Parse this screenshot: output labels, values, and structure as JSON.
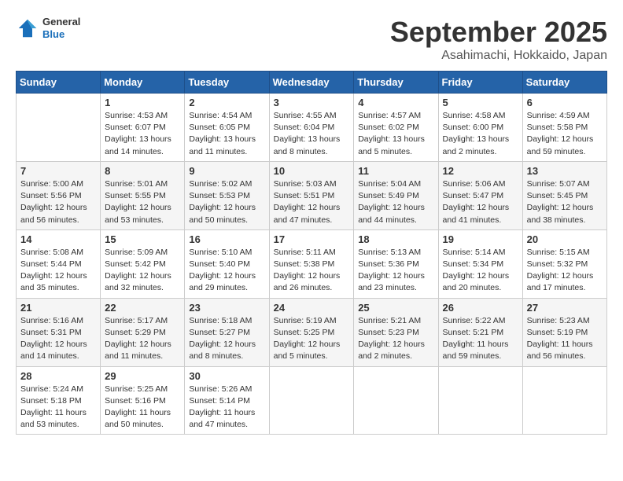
{
  "header": {
    "logo_general": "General",
    "logo_blue": "Blue",
    "month": "September 2025",
    "location": "Asahimachi, Hokkaido, Japan"
  },
  "weekdays": [
    "Sunday",
    "Monday",
    "Tuesday",
    "Wednesday",
    "Thursday",
    "Friday",
    "Saturday"
  ],
  "weeks": [
    [
      {
        "day": "",
        "info": ""
      },
      {
        "day": "1",
        "info": "Sunrise: 4:53 AM\nSunset: 6:07 PM\nDaylight: 13 hours\nand 14 minutes."
      },
      {
        "day": "2",
        "info": "Sunrise: 4:54 AM\nSunset: 6:05 PM\nDaylight: 13 hours\nand 11 minutes."
      },
      {
        "day": "3",
        "info": "Sunrise: 4:55 AM\nSunset: 6:04 PM\nDaylight: 13 hours\nand 8 minutes."
      },
      {
        "day": "4",
        "info": "Sunrise: 4:57 AM\nSunset: 6:02 PM\nDaylight: 13 hours\nand 5 minutes."
      },
      {
        "day": "5",
        "info": "Sunrise: 4:58 AM\nSunset: 6:00 PM\nDaylight: 13 hours\nand 2 minutes."
      },
      {
        "day": "6",
        "info": "Sunrise: 4:59 AM\nSunset: 5:58 PM\nDaylight: 12 hours\nand 59 minutes."
      }
    ],
    [
      {
        "day": "7",
        "info": "Sunrise: 5:00 AM\nSunset: 5:56 PM\nDaylight: 12 hours\nand 56 minutes."
      },
      {
        "day": "8",
        "info": "Sunrise: 5:01 AM\nSunset: 5:55 PM\nDaylight: 12 hours\nand 53 minutes."
      },
      {
        "day": "9",
        "info": "Sunrise: 5:02 AM\nSunset: 5:53 PM\nDaylight: 12 hours\nand 50 minutes."
      },
      {
        "day": "10",
        "info": "Sunrise: 5:03 AM\nSunset: 5:51 PM\nDaylight: 12 hours\nand 47 minutes."
      },
      {
        "day": "11",
        "info": "Sunrise: 5:04 AM\nSunset: 5:49 PM\nDaylight: 12 hours\nand 44 minutes."
      },
      {
        "day": "12",
        "info": "Sunrise: 5:06 AM\nSunset: 5:47 PM\nDaylight: 12 hours\nand 41 minutes."
      },
      {
        "day": "13",
        "info": "Sunrise: 5:07 AM\nSunset: 5:45 PM\nDaylight: 12 hours\nand 38 minutes."
      }
    ],
    [
      {
        "day": "14",
        "info": "Sunrise: 5:08 AM\nSunset: 5:44 PM\nDaylight: 12 hours\nand 35 minutes."
      },
      {
        "day": "15",
        "info": "Sunrise: 5:09 AM\nSunset: 5:42 PM\nDaylight: 12 hours\nand 32 minutes."
      },
      {
        "day": "16",
        "info": "Sunrise: 5:10 AM\nSunset: 5:40 PM\nDaylight: 12 hours\nand 29 minutes."
      },
      {
        "day": "17",
        "info": "Sunrise: 5:11 AM\nSunset: 5:38 PM\nDaylight: 12 hours\nand 26 minutes."
      },
      {
        "day": "18",
        "info": "Sunrise: 5:13 AM\nSunset: 5:36 PM\nDaylight: 12 hours\nand 23 minutes."
      },
      {
        "day": "19",
        "info": "Sunrise: 5:14 AM\nSunset: 5:34 PM\nDaylight: 12 hours\nand 20 minutes."
      },
      {
        "day": "20",
        "info": "Sunrise: 5:15 AM\nSunset: 5:32 PM\nDaylight: 12 hours\nand 17 minutes."
      }
    ],
    [
      {
        "day": "21",
        "info": "Sunrise: 5:16 AM\nSunset: 5:31 PM\nDaylight: 12 hours\nand 14 minutes."
      },
      {
        "day": "22",
        "info": "Sunrise: 5:17 AM\nSunset: 5:29 PM\nDaylight: 12 hours\nand 11 minutes."
      },
      {
        "day": "23",
        "info": "Sunrise: 5:18 AM\nSunset: 5:27 PM\nDaylight: 12 hours\nand 8 minutes."
      },
      {
        "day": "24",
        "info": "Sunrise: 5:19 AM\nSunset: 5:25 PM\nDaylight: 12 hours\nand 5 minutes."
      },
      {
        "day": "25",
        "info": "Sunrise: 5:21 AM\nSunset: 5:23 PM\nDaylight: 12 hours\nand 2 minutes."
      },
      {
        "day": "26",
        "info": "Sunrise: 5:22 AM\nSunset: 5:21 PM\nDaylight: 11 hours\nand 59 minutes."
      },
      {
        "day": "27",
        "info": "Sunrise: 5:23 AM\nSunset: 5:19 PM\nDaylight: 11 hours\nand 56 minutes."
      }
    ],
    [
      {
        "day": "28",
        "info": "Sunrise: 5:24 AM\nSunset: 5:18 PM\nDaylight: 11 hours\nand 53 minutes."
      },
      {
        "day": "29",
        "info": "Sunrise: 5:25 AM\nSunset: 5:16 PM\nDaylight: 11 hours\nand 50 minutes."
      },
      {
        "day": "30",
        "info": "Sunrise: 5:26 AM\nSunset: 5:14 PM\nDaylight: 11 hours\nand 47 minutes."
      },
      {
        "day": "",
        "info": ""
      },
      {
        "day": "",
        "info": ""
      },
      {
        "day": "",
        "info": ""
      },
      {
        "day": "",
        "info": ""
      }
    ]
  ]
}
